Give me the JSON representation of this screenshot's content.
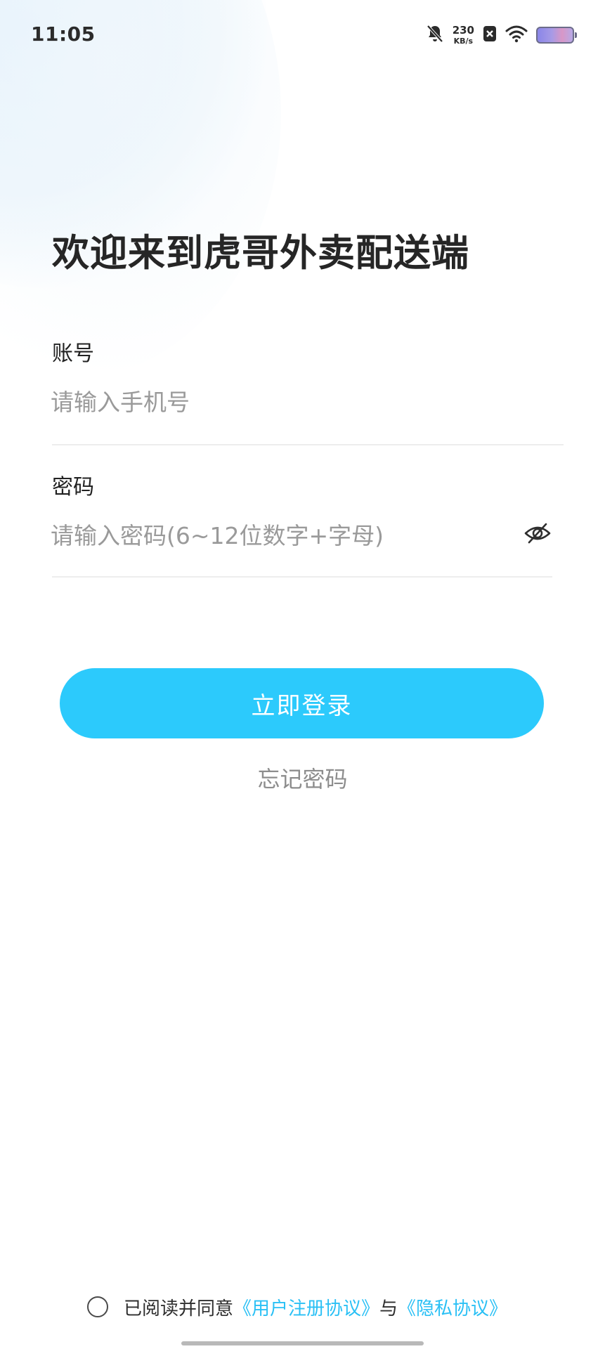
{
  "status_bar": {
    "time": "11:05",
    "network_speed_value": "230",
    "network_speed_unit": "KB/s",
    "icons": [
      "bell-muted-icon",
      "close-box-icon",
      "wifi-icon",
      "battery-icon"
    ]
  },
  "page": {
    "welcome_title": "欢迎来到虎哥外卖配送端"
  },
  "account": {
    "label": "账号",
    "value": "",
    "placeholder": "请输入手机号"
  },
  "password": {
    "label": "密码",
    "value": "",
    "placeholder": "请输入密码(6~12位数字+字母)",
    "visibility_icon": "eye-off-icon"
  },
  "actions": {
    "login_label": "立即登录",
    "forgot_label": "忘记密码"
  },
  "agreement": {
    "prefix": "已阅读并同意",
    "user_agreement": "《用户注册协议》",
    "conjunction": "与",
    "privacy_agreement": "《隐私协议》"
  },
  "colors": {
    "primary": "#2ccafc",
    "link": "#2ac0f5",
    "text_dark": "#262626",
    "placeholder": "#9a9a9a"
  }
}
